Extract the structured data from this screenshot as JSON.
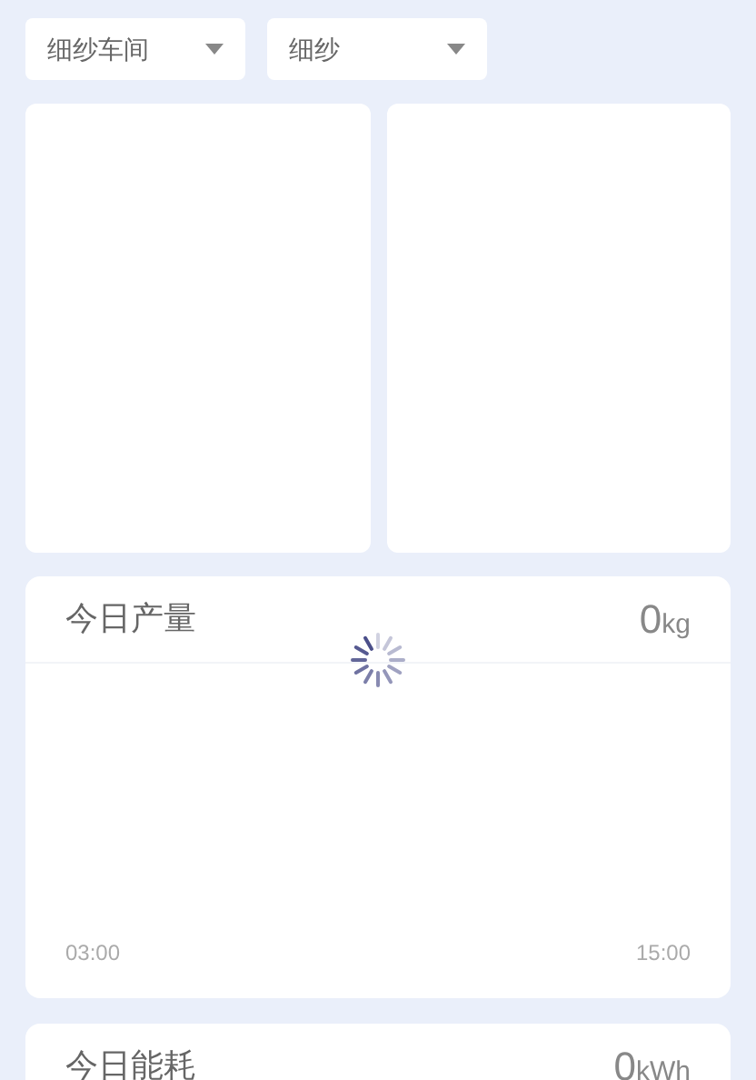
{
  "filters": [
    {
      "value": "细纱车间"
    },
    {
      "value": "细纱"
    }
  ],
  "cards": [
    {
      "title": "今日产量",
      "value": "0",
      "unit": "kg",
      "loading": true,
      "axis_labels": [
        "03:00",
        "15:00"
      ]
    },
    {
      "title": "今日能耗",
      "value": "0",
      "unit": "kWh"
    }
  ]
}
